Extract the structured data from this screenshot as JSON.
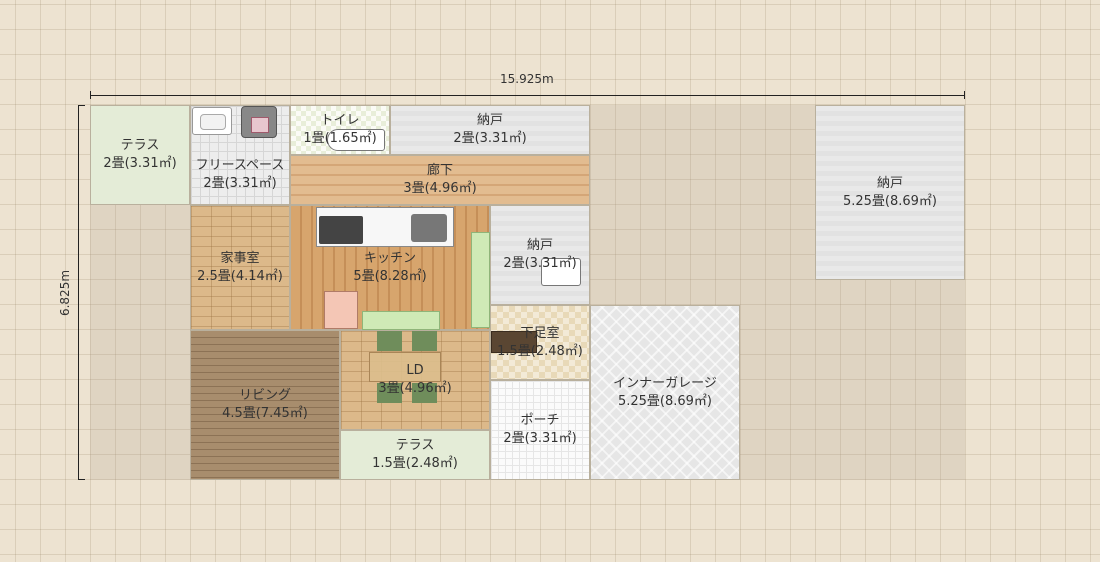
{
  "dimensions": {
    "width_label": "15.925m",
    "height_label": "6.825m"
  },
  "rooms": [
    {
      "name": "テラス",
      "area": "2畳(3.31㎡)"
    },
    {
      "name": "フリースペース",
      "area": "2畳(3.31㎡)"
    },
    {
      "name": "トイレ",
      "area": "1畳(1.65㎡)"
    },
    {
      "name": "納戸",
      "area": "2畳(3.31㎡)"
    },
    {
      "name": "廊下",
      "area": "3畳(4.96㎡)"
    },
    {
      "name": "納戸",
      "area": "5.25畳(8.69㎡)"
    },
    {
      "name": "家事室",
      "area": "2.5畳(4.14㎡)"
    },
    {
      "name": "キッチン",
      "area": "5畳(8.28㎡)"
    },
    {
      "name": "納戸",
      "area": "2畳(3.31㎡)"
    },
    {
      "name": "下足室",
      "area": "1.5畳(2.48㎡)"
    },
    {
      "name": "インナーガレージ",
      "area": "5.25畳(8.69㎡)"
    },
    {
      "name": "リビング",
      "area": "4.5畳(7.45㎡)"
    },
    {
      "name": "LD",
      "area": "3畳(4.96㎡)"
    },
    {
      "name": "ポーチ",
      "area": "2畳(3.31㎡)"
    },
    {
      "name": "テラス",
      "area": "1.5畳(2.48㎡)"
    }
  ]
}
